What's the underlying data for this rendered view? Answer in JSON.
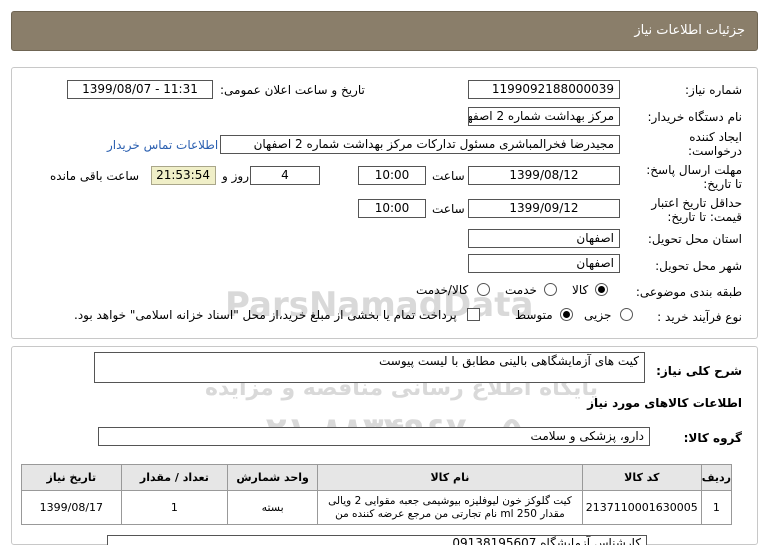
{
  "header": {
    "title": "جزئیات اطلاعات نیاز"
  },
  "fields": {
    "need_number_label": "شماره نیاز:",
    "need_number": "1199092188000039",
    "announce_label": "تاریخ و ساعت اعلان عمومی:",
    "announce_value": "1399/08/07 - 11:31",
    "buyer_label": "نام دستگاه خریدار:",
    "buyer": "مرکز بهداشت شماره 2 اصفهان",
    "creator_label_1": "ایجاد کننده",
    "creator_label_2": "درخواست:",
    "creator": "مجیدرضا فخرالمباشری مسئول تدارکات مرکز بهداشت شماره 2 اصفهان",
    "contact_link": "اطلاعات تماس خریدار",
    "reply_label_1": "مهلت ارسال پاسخ:",
    "reply_label_2": "تا تاریخ:",
    "reply_date": "1399/08/12",
    "time_label": "ساعت",
    "reply_time": "10:00",
    "days_value": "4",
    "days_label": "روز و",
    "remaining_time": "21:53:54",
    "remaining_label": "ساعت باقی مانده",
    "validity_label_1": "حداقل تاریخ اعتبار",
    "validity_label_2": "قیمت: تا تاریخ:",
    "validity_date": "1399/09/12",
    "validity_time": "10:00",
    "province_label": "استان محل تحویل:",
    "province": "اصفهان",
    "city_label": "شهر محل تحویل:",
    "city": "اصفهان",
    "category_label": "طبقه بندی موضوعی:",
    "category_options": [
      "کالا",
      "خدمت",
      "کالا/خدمت"
    ],
    "process_label": "نوع فرآیند خرید :",
    "process_options": [
      "جزیی",
      "متوسط"
    ],
    "payment_note": "پرداخت تمام یا بخشی از مبلغ خرید،از محل \"اسناد خزانه اسلامی\" خواهد بود."
  },
  "summary": {
    "label": "شرح کلی نیاز:",
    "text": "کیت های آزمایشگاهی بالینی مطابق با لیست پیوست"
  },
  "goods": {
    "section_title": "اطلاعات کالاهای مورد نیاز",
    "group_label": "گروه کالا:",
    "group_value": "دارو، پزشکی و سلامت",
    "columns": [
      "ردیف",
      "کد کالا",
      "نام کالا",
      "واحد شمارش",
      "تعداد / مقدار",
      "تاریخ نیاز"
    ],
    "rows": [
      {
        "row": "1",
        "code": "2137110001630005",
        "name": "کیت گلوکز خون لیوفلیزه بیوشیمی جعبه مقوایی 2 ویالی مقدار 250 ml نام تجارتی من مرجع عرضه کننده من",
        "unit": "بسته",
        "qty": "1",
        "date": "1399/08/17"
      }
    ]
  },
  "footer_note": "کارشناس آزمایشگاه 09138195607",
  "watermark": {
    "line1": "ParsNamadData",
    "line2": "پایگاه اطلاع رسانی مناقصه و مزایده",
    "line3": "۰۲۱-۸۸۳۴۹۶۷۰-۵"
  }
}
